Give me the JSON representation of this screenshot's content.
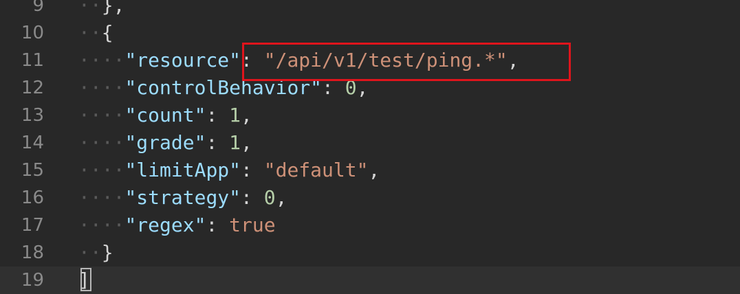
{
  "lines": [
    {
      "num": "9",
      "tokens": [
        {
          "t": "indent",
          "v": "··"
        },
        {
          "t": "punct",
          "v": "},"
        }
      ]
    },
    {
      "num": "10",
      "tokens": [
        {
          "t": "indent",
          "v": "··"
        },
        {
          "t": "punct",
          "v": "{"
        }
      ]
    },
    {
      "num": "11",
      "tokens": [
        {
          "t": "indent",
          "v": "····"
        },
        {
          "t": "key",
          "v": "\"resource\""
        },
        {
          "t": "punct",
          "v": ": "
        },
        {
          "t": "str",
          "v": "\"/api/v1/test/ping.*\""
        },
        {
          "t": "punct",
          "v": ","
        }
      ]
    },
    {
      "num": "12",
      "tokens": [
        {
          "t": "indent",
          "v": "····"
        },
        {
          "t": "key",
          "v": "\"controlBehavior\""
        },
        {
          "t": "punct",
          "v": ": "
        },
        {
          "t": "num",
          "v": "0"
        },
        {
          "t": "punct",
          "v": ","
        }
      ]
    },
    {
      "num": "13",
      "tokens": [
        {
          "t": "indent",
          "v": "····"
        },
        {
          "t": "key",
          "v": "\"count\""
        },
        {
          "t": "punct",
          "v": ": "
        },
        {
          "t": "num",
          "v": "1"
        },
        {
          "t": "punct",
          "v": ","
        }
      ]
    },
    {
      "num": "14",
      "tokens": [
        {
          "t": "indent",
          "v": "····"
        },
        {
          "t": "key",
          "v": "\"grade\""
        },
        {
          "t": "punct",
          "v": ": "
        },
        {
          "t": "num",
          "v": "1"
        },
        {
          "t": "punct",
          "v": ","
        }
      ]
    },
    {
      "num": "15",
      "tokens": [
        {
          "t": "indent",
          "v": "····"
        },
        {
          "t": "key",
          "v": "\"limitApp\""
        },
        {
          "t": "punct",
          "v": ": "
        },
        {
          "t": "str",
          "v": "\"default\""
        },
        {
          "t": "punct",
          "v": ","
        }
      ]
    },
    {
      "num": "16",
      "tokens": [
        {
          "t": "indent",
          "v": "····"
        },
        {
          "t": "key",
          "v": "\"strategy\""
        },
        {
          "t": "punct",
          "v": ": "
        },
        {
          "t": "num",
          "v": "0"
        },
        {
          "t": "punct",
          "v": ","
        }
      ]
    },
    {
      "num": "17",
      "tokens": [
        {
          "t": "indent",
          "v": "····"
        },
        {
          "t": "key",
          "v": "\"regex\""
        },
        {
          "t": "punct",
          "v": ": "
        },
        {
          "t": "kw",
          "v": "true"
        }
      ]
    },
    {
      "num": "18",
      "tokens": [
        {
          "t": "indent",
          "v": "··"
        },
        {
          "t": "punct",
          "v": "}"
        }
      ]
    },
    {
      "num": "19",
      "tokens": [
        {
          "t": "punct",
          "v": "]"
        }
      ]
    }
  ],
  "colors": {
    "background": "#282828",
    "key": "#9cdcfe",
    "string": "#ce9178",
    "number": "#b5cea8",
    "highlight_border": "#e0141c"
  }
}
